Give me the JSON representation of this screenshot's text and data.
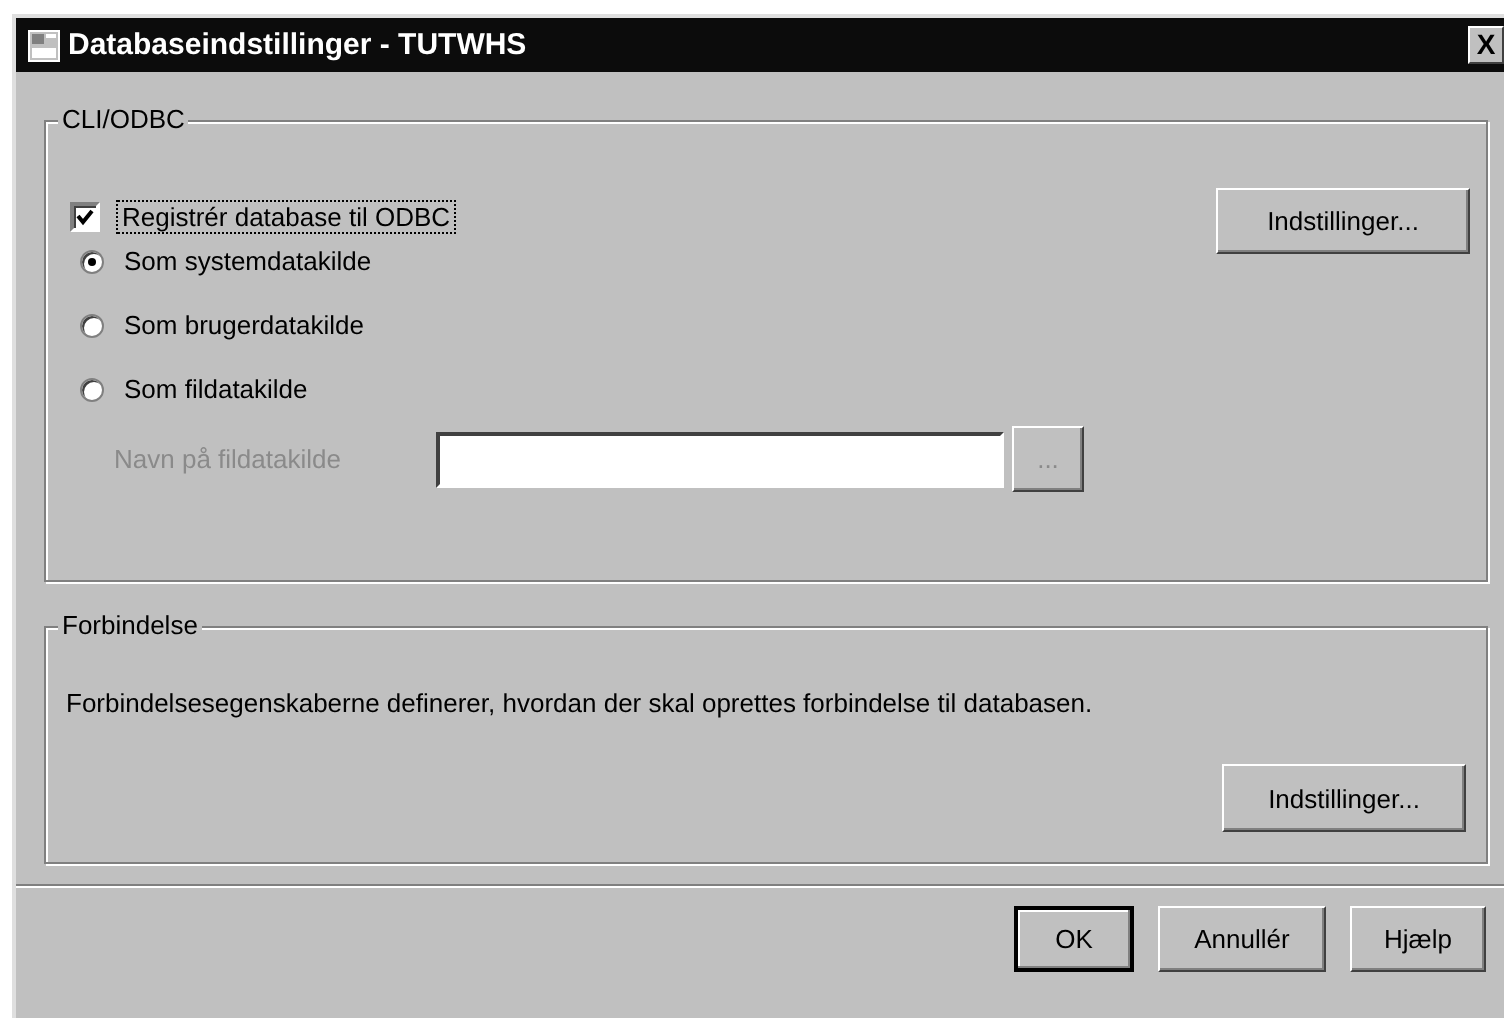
{
  "window": {
    "title": "Databaseindstillinger - TUTWHS",
    "close": "X"
  },
  "cli_odbc": {
    "title": "CLI/ODBC",
    "register": {
      "label": "Registrér database til ODBC",
      "checked": true
    },
    "settings_button": "Indstillinger...",
    "radios": [
      {
        "label": "Som systemdatakilde",
        "selected": true
      },
      {
        "label": "Som brugerdatakilde",
        "selected": false
      },
      {
        "label": "Som fildatakilde",
        "selected": false
      }
    ],
    "file_name": {
      "label": "Navn på fildatakilde",
      "disabled": true,
      "browse": "..."
    }
  },
  "connection": {
    "title": "Forbindelse",
    "description": "Forbindelsesegenskaberne definerer, hvordan der skal oprettes forbindelse til databasen.",
    "settings_button": "Indstillinger..."
  },
  "buttons": [
    {
      "label": "OK",
      "default": true
    },
    {
      "label": "Annullér",
      "default": false
    },
    {
      "label": "Hjælp",
      "default": false
    }
  ]
}
